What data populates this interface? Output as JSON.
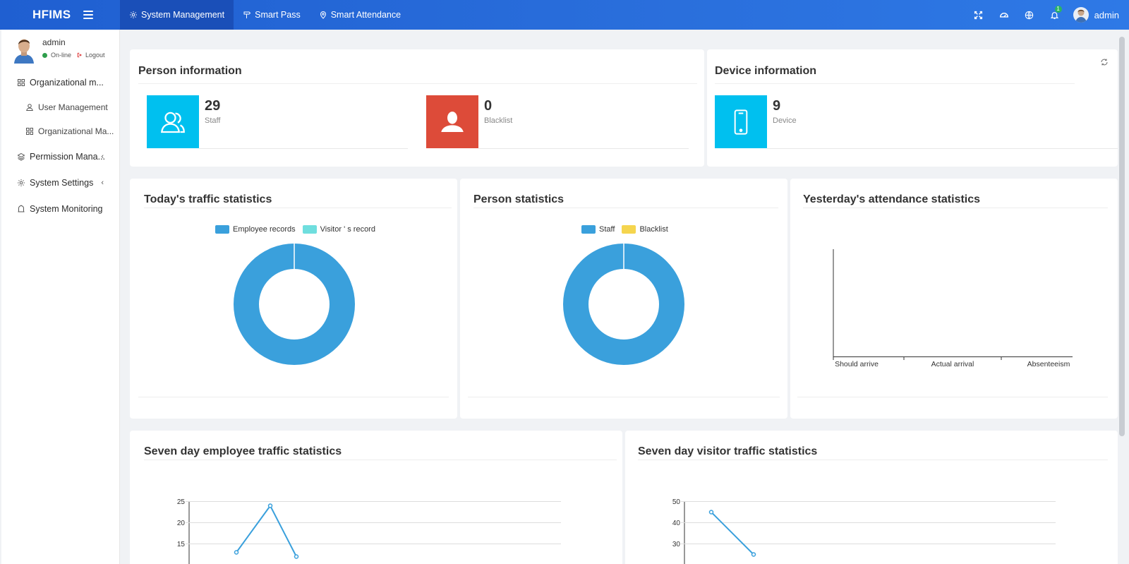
{
  "header": {
    "brand": "HFIMS",
    "nav": [
      {
        "label": "System Management",
        "active": true
      },
      {
        "label": "Smart Pass",
        "active": false
      },
      {
        "label": "Smart Attendance",
        "active": false
      }
    ],
    "notifications_count": "1",
    "user": "admin"
  },
  "sidebar": {
    "user_name": "admin",
    "status": "On-line",
    "logout": "Logout",
    "items": [
      {
        "label": "Organizational m..."
      },
      {
        "label": "User Management"
      },
      {
        "label": "Organizational Ma..."
      },
      {
        "label": "Permission Mana..."
      },
      {
        "label": "System Settings"
      },
      {
        "label": "System Monitoring"
      }
    ]
  },
  "person_info": {
    "title": "Person information",
    "staff": {
      "value": "29",
      "label": "Staff"
    },
    "blacklist": {
      "value": "0",
      "label": "Blacklist"
    }
  },
  "device_info": {
    "title": "Device information",
    "device": {
      "value": "9",
      "label": "Device"
    }
  },
  "colors": {
    "accent": "#00c0ef",
    "danger": "#dd4b39",
    "chart_blue": "#3aa0dc",
    "chart_cyan": "#6fdede",
    "chart_yellow": "#f5d54e"
  },
  "chart_data": [
    {
      "type": "pie",
      "title": "Today's traffic statistics",
      "donut": true,
      "legend_placement": "top",
      "series": [
        {
          "name": "Employee records",
          "value": 100
        },
        {
          "name": "Visitor ' s record",
          "value": 0
        }
      ]
    },
    {
      "type": "pie",
      "title": "Person statistics",
      "donut": true,
      "legend_placement": "top",
      "series": [
        {
          "name": "Staff",
          "value": 29
        },
        {
          "name": "Blacklist",
          "value": 0
        }
      ]
    },
    {
      "type": "bar",
      "title": "Yesterday's attendance statistics",
      "categories": [
        "Should arrive",
        "Actual arrival",
        "Absenteeism"
      ],
      "values": [
        0,
        0,
        0
      ]
    },
    {
      "type": "line",
      "title": "Seven day employee traffic statistics",
      "ylim": [
        15,
        25
      ],
      "yticks": [
        25,
        20,
        15
      ],
      "values": [
        13,
        24,
        12
      ],
      "grid": true
    },
    {
      "type": "line",
      "title": "Seven day visitor traffic statistics",
      "ylim": [
        30,
        50
      ],
      "yticks": [
        50,
        40,
        30
      ],
      "values": [
        45,
        25
      ],
      "grid": true
    }
  ]
}
